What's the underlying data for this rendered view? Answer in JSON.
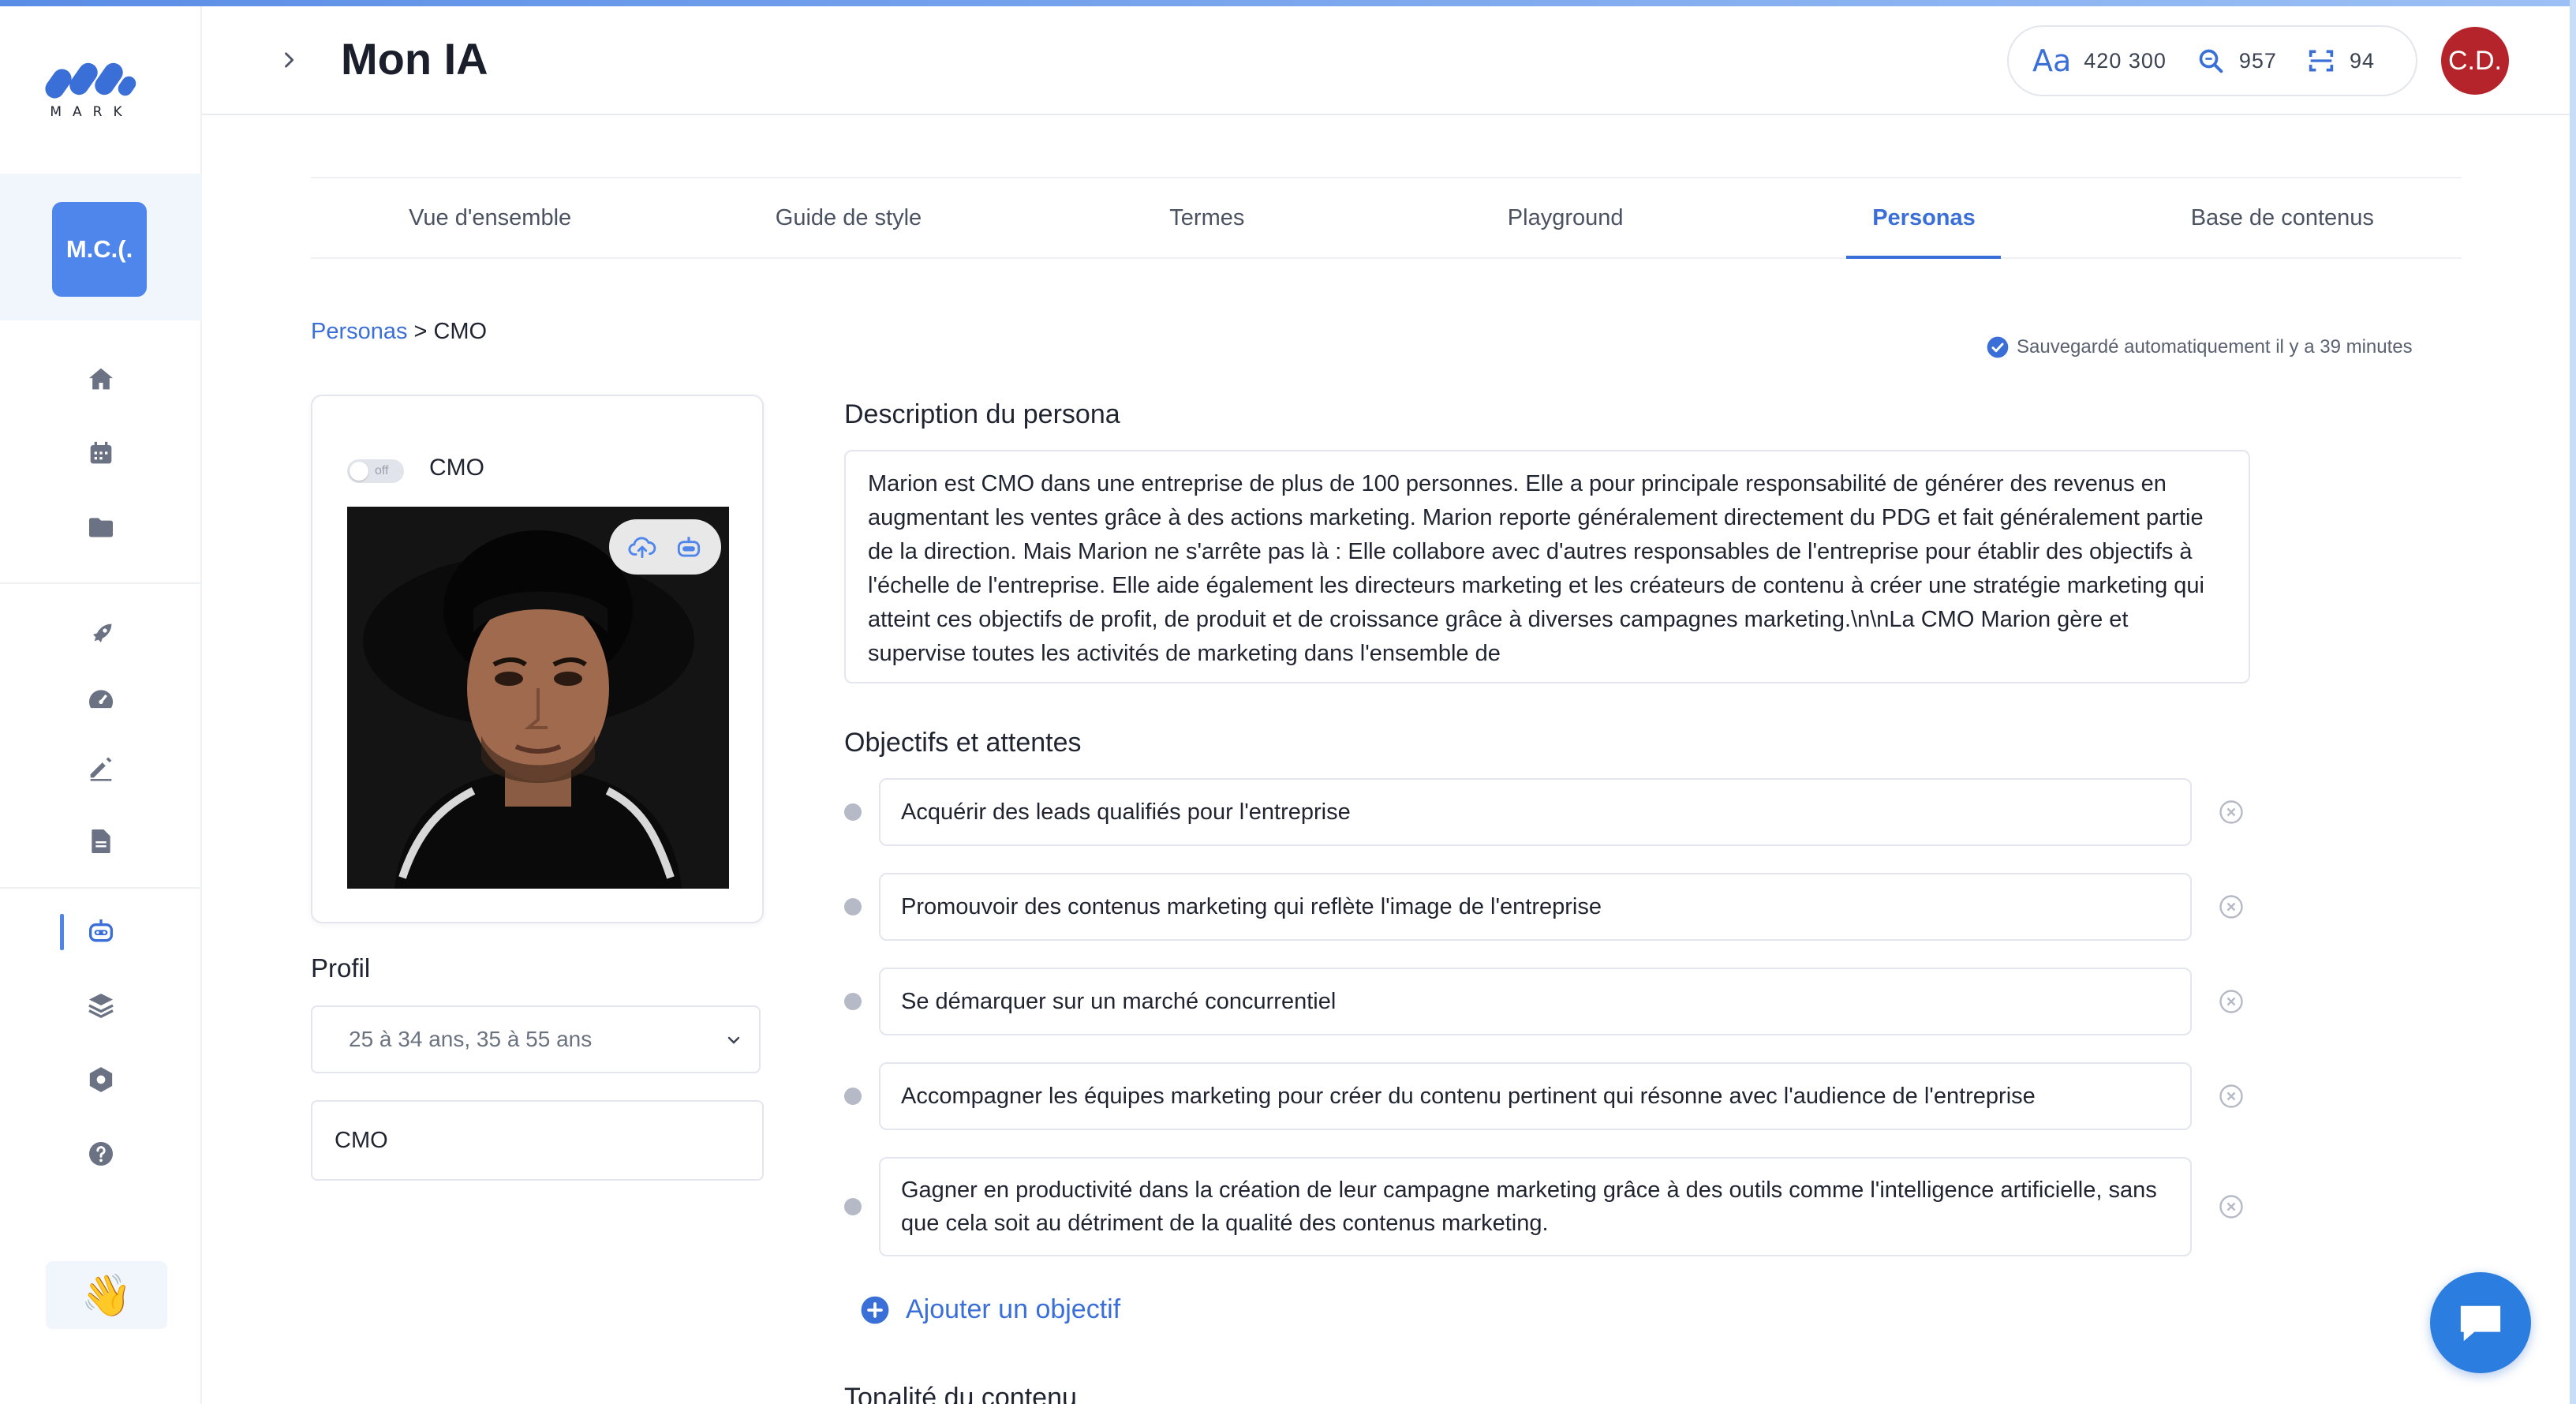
{
  "app": {
    "logo_text": "MARK",
    "workspace_initials": "M.C.(.",
    "avatar_initials": "C.D.",
    "wave_emoji": "👋"
  },
  "header": {
    "title": "Mon IA",
    "stats": [
      {
        "icon": "font-size-icon",
        "label": "Aa",
        "value": "420 300"
      },
      {
        "icon": "search-icon",
        "value": "957"
      },
      {
        "icon": "scan-icon",
        "value": "94"
      }
    ]
  },
  "tabs": [
    {
      "label": "Vue d'ensemble",
      "active": false
    },
    {
      "label": "Guide de style",
      "active": false
    },
    {
      "label": "Termes",
      "active": false
    },
    {
      "label": "Playground",
      "active": false
    },
    {
      "label": "Personas",
      "active": true
    },
    {
      "label": "Base de contenus",
      "active": false
    }
  ],
  "breadcrumb": {
    "parent": "Personas",
    "separator": ">",
    "current": "CMO"
  },
  "autosave_text": "Sauvegardé automatiquement il y a 39 minutes",
  "persona": {
    "toggle_label": "off",
    "name": "CMO",
    "profil_label": "Profil",
    "age_select": "25 à 34 ans, 35 à 55 ans",
    "role_value": "CMO"
  },
  "description": {
    "title": "Description du persona",
    "text": "Marion est CMO dans une entreprise de plus de 100 personnes. Elle a pour principale responsabilité de générer des revenus en augmentant les ventes grâce à des actions marketing. Marion reporte généralement directement du PDG et fait généralement partie de la direction. Mais Marion ne s'arrête pas là : Elle collabore avec d'autres responsables de l'entreprise pour établir des objectifs à l'échelle de l'entreprise. Elle aide également les directeurs marketing et les créateurs de contenu à créer une stratégie marketing qui atteint ces objectifs de profit, de produit et de croissance grâce à diverses campagnes marketing.\\n\\nLa CMO Marion gère et supervise toutes les activités de marketing dans l'ensemble de"
  },
  "objectives": {
    "title": "Objectifs et attentes",
    "items": [
      "Acquérir des leads qualifiés pour l'entreprise",
      "Promouvoir des contenus marketing qui reflète l'image de l'entreprise",
      "Se démarquer sur un marché concurrentiel",
      "Accompagner les équipes marketing pour créer du contenu pertinent qui résonne avec l'audience de l'entreprise",
      "Gagner en productivité dans la création de leur campagne marketing grâce à des outils comme l'intelligence artificielle, sans que cela soit au détriment de la qualité des contenus marketing."
    ],
    "add_label": "Ajouter un objectif"
  },
  "next_section_title": "Tonalité du contenu",
  "colors": {
    "accent": "#3a6fd8",
    "avatar": "#b4242a",
    "chat": "#2b7de0"
  }
}
